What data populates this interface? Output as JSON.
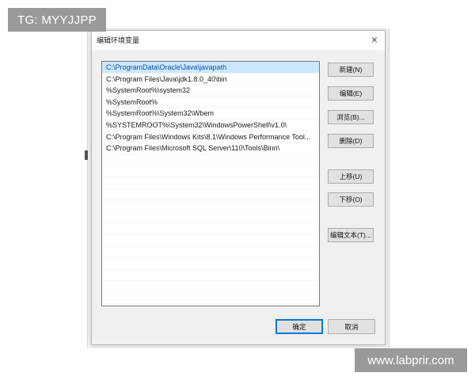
{
  "watermarks": {
    "top_left": "TG: MYYJJPP",
    "bottom_right": "www.labprir.com"
  },
  "dialog": {
    "title": "编辑环境变量",
    "close_glyph": "×"
  },
  "paths": [
    "C:\\ProgramData\\Oracle\\Java\\javapath",
    "C:\\Program Files\\Java\\jdk1.8.0_40\\bin",
    "%SystemRoot%\\system32",
    "%SystemRoot%",
    "%SystemRoot%\\System32\\Wbem",
    "%SYSTEMROOT%\\System32\\WindowsPowerShell\\v1.0\\",
    "C:\\Program Files\\Windows Kits\\8.1\\Windows Performance Tool...",
    "C:\\Program Files\\Microsoft SQL Server\\110\\Tools\\Binn\\"
  ],
  "selected_index": 0,
  "buttons": {
    "new": "新建(N)",
    "edit": "编辑(E)",
    "browse": "浏览(B)...",
    "delete": "删除(D)",
    "move_up": "上移(U)",
    "move_down": "下移(O)",
    "edit_text": "编辑文本(T)...",
    "ok": "确定",
    "cancel": "取消"
  }
}
